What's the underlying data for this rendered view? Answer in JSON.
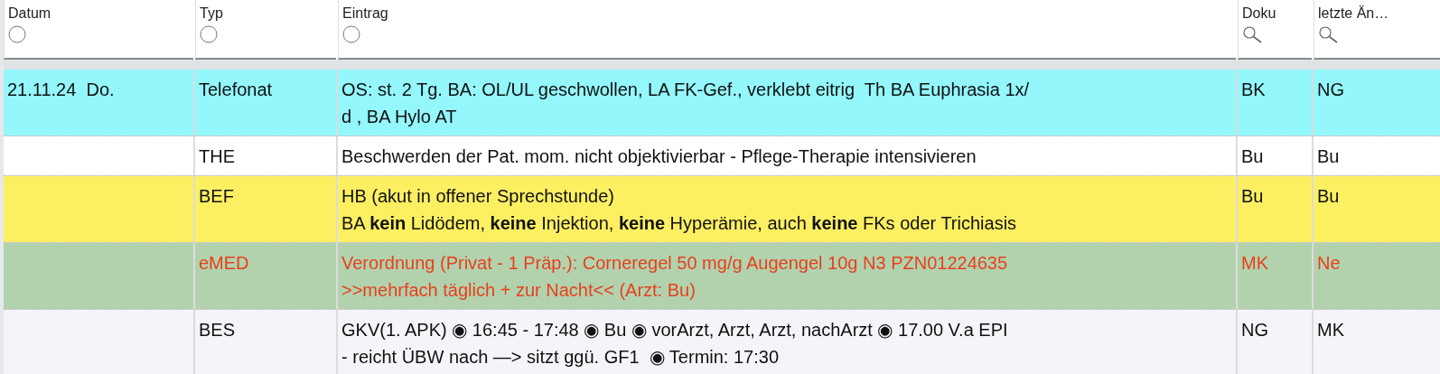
{
  "columns": [
    {
      "label": "Datum",
      "kind": "circle"
    },
    {
      "label": "Typ",
      "kind": "circle"
    },
    {
      "label": "Eintrag",
      "kind": "circle"
    },
    {
      "label": "Doku",
      "kind": "search"
    },
    {
      "label": "letzte Än…",
      "kind": "search"
    }
  ],
  "rows": [
    {
      "color": "#93f7fc",
      "kind": "entry",
      "datum": "21.11.24  Do.",
      "typ": "Telefonat",
      "lines": [
        "OS: st. 2 Tg. BA: OL/UL geschwollen, LA FK-Gef., verklebt eitrig  Th BA Euphrasia 1x/",
        "d , BA Hylo AT"
      ],
      "doku": "BK",
      "letzte": "NG"
    },
    {
      "color": "#ffffff",
      "kind": "entry",
      "typ": "THE",
      "lines": [
        "Beschwerden der Pat. mom. nicht objektivierbar - Pflege-Therapie intensivieren"
      ],
      "doku": "Bu",
      "letzte": "Bu"
    },
    {
      "color": "#fdef62",
      "kind": "entry",
      "typ": "BEF",
      "lines": [
        "HB (akut in offener Sprechstunde)",
        "BA **kein** Lidödem, **keine** Injektion, **keine** Hyperämie, auch **keine** FKs oder Trichiasis"
      ],
      "doku": "Bu",
      "letzte": "Bu"
    },
    {
      "color": "#b2d2ae",
      "kind": "prescription",
      "typ": "eMED",
      "lines": [
        "Verordnung (Privat - 1 Präp.): Corneregel 50 mg/g Augengel 10g N3 PZN01224635",
        ">>mehrfach täglich + zur Nacht<< (Arzt: Bu)"
      ],
      "doku": "MK",
      "letzte": "Ne"
    },
    {
      "color": "#f3f5f8",
      "kind": "entry",
      "typ": "BES",
      "lines": [
        "GKV(1. APK) ◉ 16:45 - 17:48 ◉ Bu ◉ vorArzt, Arzt, Arzt, nachArzt ◉ 17.00 V.a EPI",
        "- reicht ÜBW nach —> sitzt ggü. GF1  ◉ Termin: 17:30"
      ],
      "doku": "NG",
      "letzte": "MK"
    }
  ]
}
